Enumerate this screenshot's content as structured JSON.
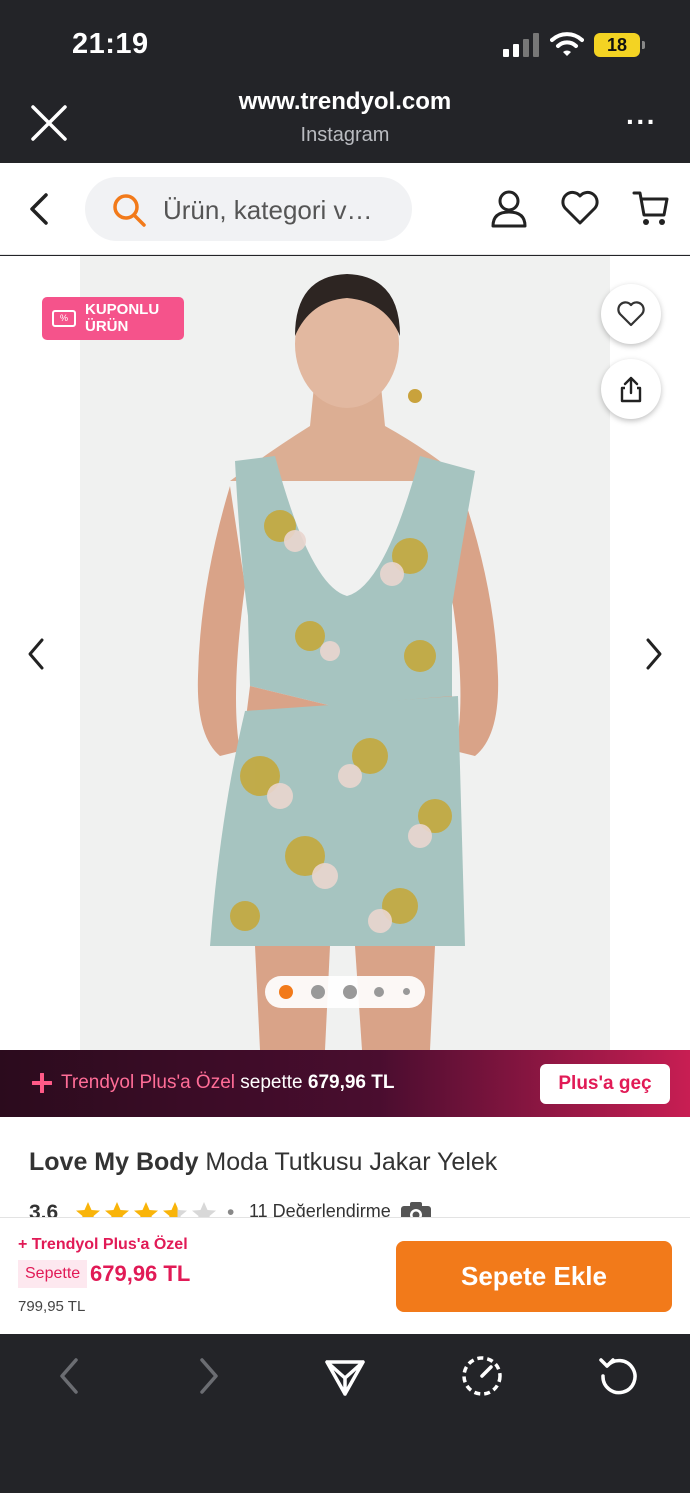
{
  "status_bar": {
    "time": "21:19",
    "battery": "18"
  },
  "browser": {
    "url": "www.trendyol.com",
    "source": "Instagram",
    "close_icon": "close-icon",
    "more_icon": "more-dots-icon"
  },
  "app_header": {
    "search_placeholder": "Ürün, kategori v…",
    "icons": [
      "back-icon",
      "search-icon",
      "user-icon",
      "heart-icon",
      "cart-icon"
    ],
    "accent_color": "#f27a1a"
  },
  "gallery": {
    "coupon_badge": "KUPONLU ÜRÜN",
    "coupon_color": "#f5538b",
    "image_count": 5,
    "active_index": 0,
    "dot_active_color": "#f27a1a"
  },
  "plus_banner": {
    "label": "Trendyol Plus'a Özel",
    "middle": " sepette ",
    "price": "679,96 TL",
    "button": "Plus'a geç"
  },
  "product": {
    "brand": "Love My Body",
    "name": " Moda Tutkusu Jakar Yelek",
    "rating": "3.6",
    "rating_out_of_5": 3.6,
    "review_count_text": "11 Değerlendirme"
  },
  "buy_bar": {
    "plus_label": "Trendyol Plus'a Özel",
    "sepette_label": "Sepette",
    "discount_price": "679,96 TL",
    "old_price": "799,95 TL",
    "add_to_cart": "Sepete Ekle"
  },
  "toolbar": {
    "icons": [
      "back-arrow-icon",
      "forward-arrow-icon",
      "share-send-icon",
      "speedometer-icon",
      "refresh-icon"
    ]
  }
}
